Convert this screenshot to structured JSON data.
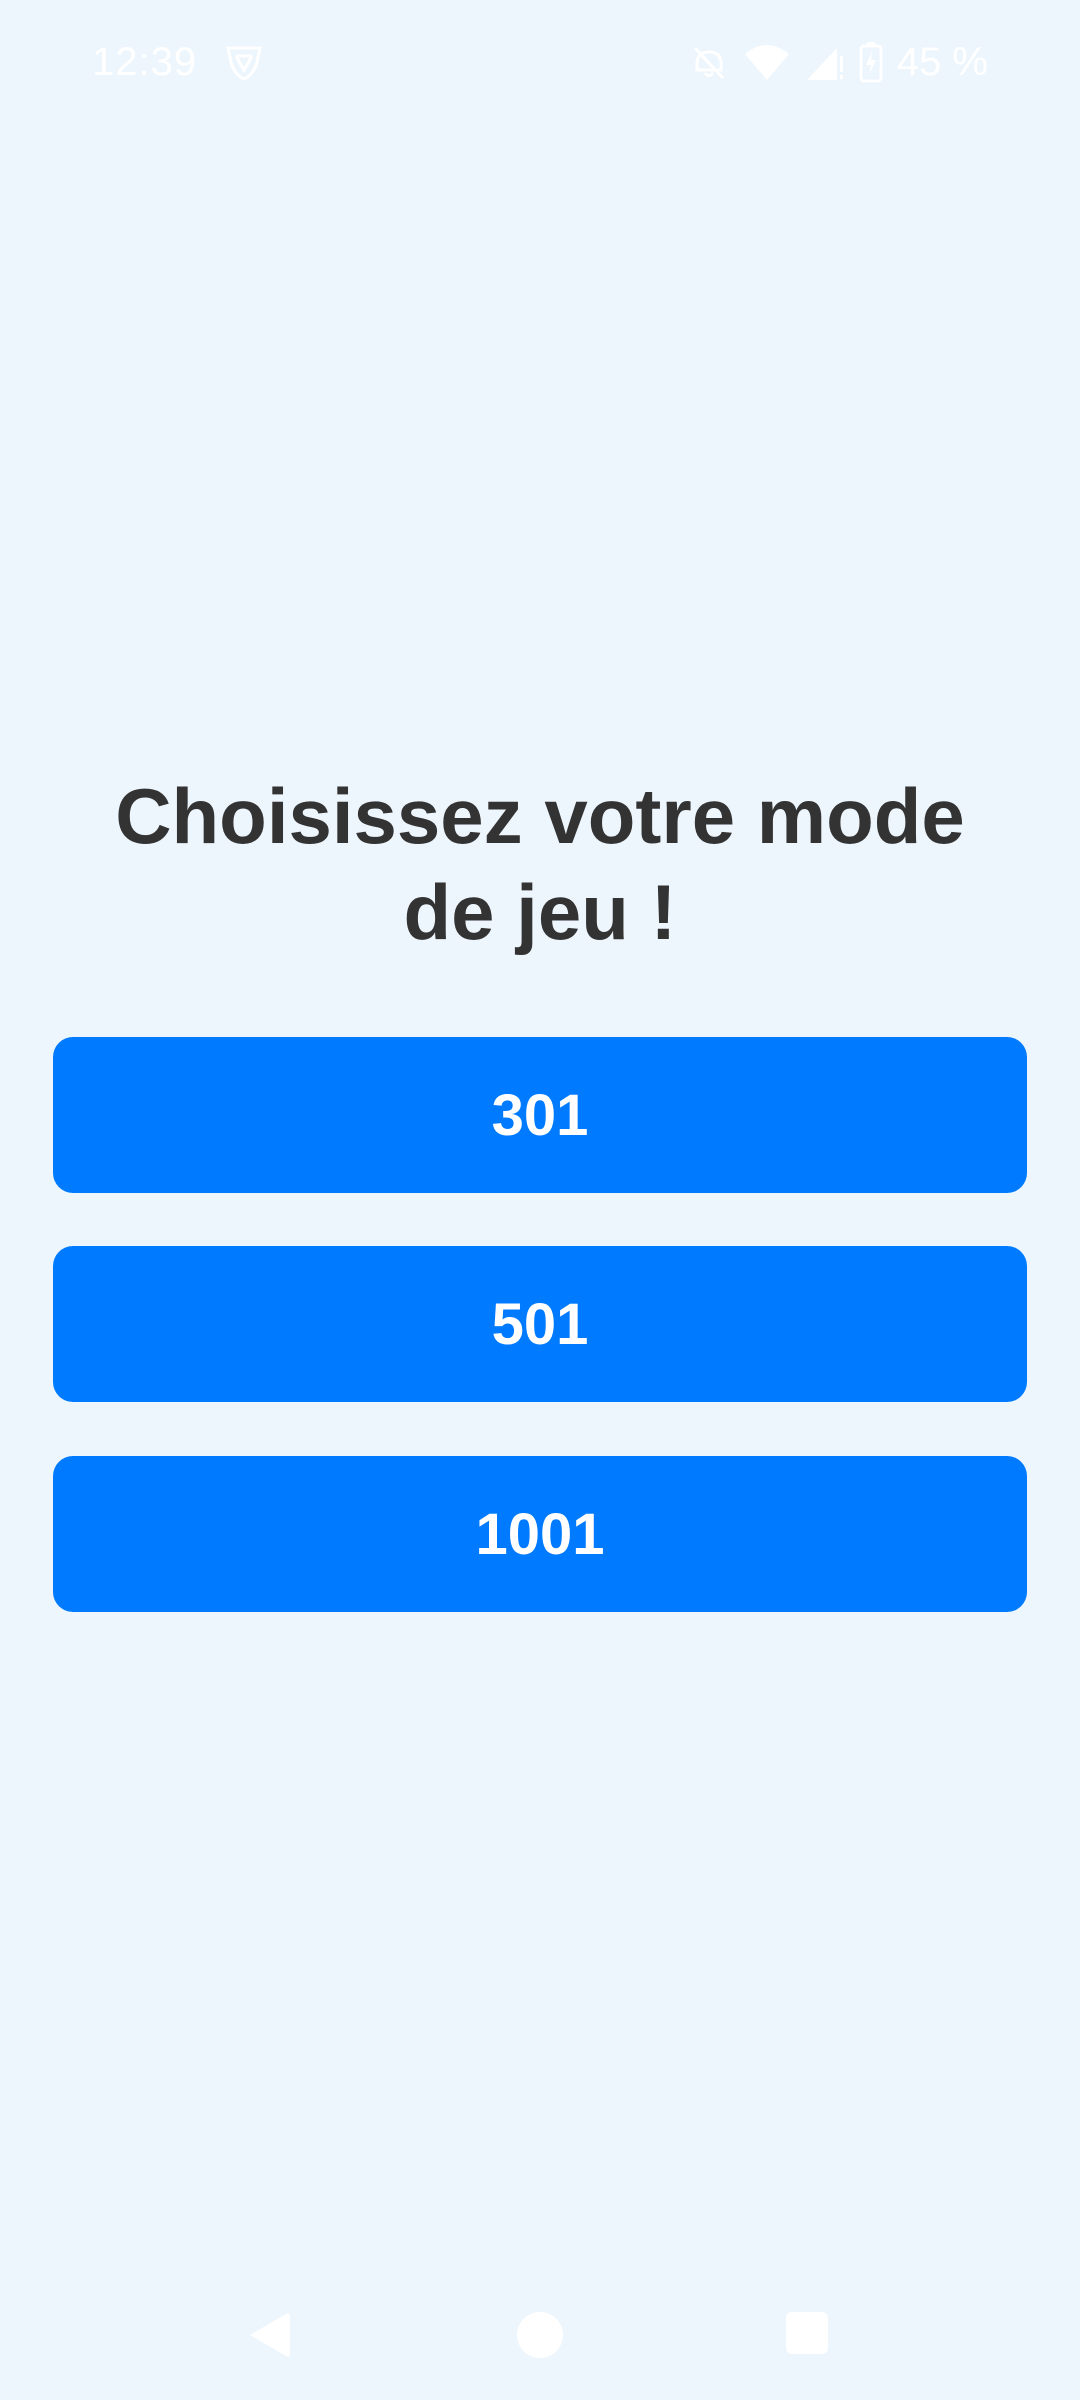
{
  "status_bar": {
    "time": "12:39",
    "battery": "45 %",
    "icons": [
      "shield-v-icon",
      "mute-icon",
      "wifi-icon",
      "signal-icon",
      "battery-charging-icon"
    ]
  },
  "main": {
    "title": "Choisissez votre mode de jeu !",
    "modes": [
      "301",
      "501",
      "1001"
    ]
  },
  "colors": {
    "background": "#eef6fd",
    "button": "#007bff",
    "button_text": "#ffffff",
    "title_text": "#333333"
  },
  "nav_bar": {
    "icons": [
      "back-icon",
      "home-icon",
      "recents-icon"
    ]
  }
}
